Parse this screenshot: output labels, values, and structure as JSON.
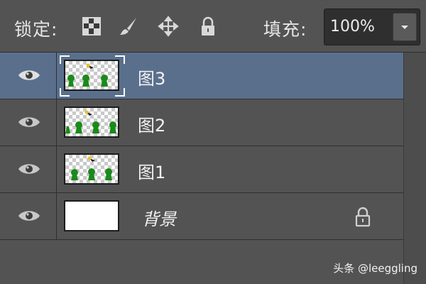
{
  "toolbar": {
    "lock_label": "锁定:",
    "lock_icons": [
      "lock-transparent-pixels-icon",
      "lock-image-pixels-icon",
      "lock-position-icon",
      "lock-all-icon"
    ],
    "fill_label": "填充:",
    "fill_value": "100%"
  },
  "layers": [
    {
      "name": "图3",
      "selected": true,
      "thumbnail": "transparent-with-trees"
    },
    {
      "name": "图2",
      "selected": false,
      "thumbnail": "transparent-with-trees"
    },
    {
      "name": "图1",
      "selected": false,
      "thumbnail": "transparent-with-trees"
    },
    {
      "name": "背景",
      "selected": false,
      "thumbnail": "white",
      "locked": true
    }
  ],
  "watermark": "头条 @leeggling",
  "colors": {
    "panel_bg": "#535353",
    "selected_row": "#5a6f8c",
    "text": "#e6e6e6"
  }
}
